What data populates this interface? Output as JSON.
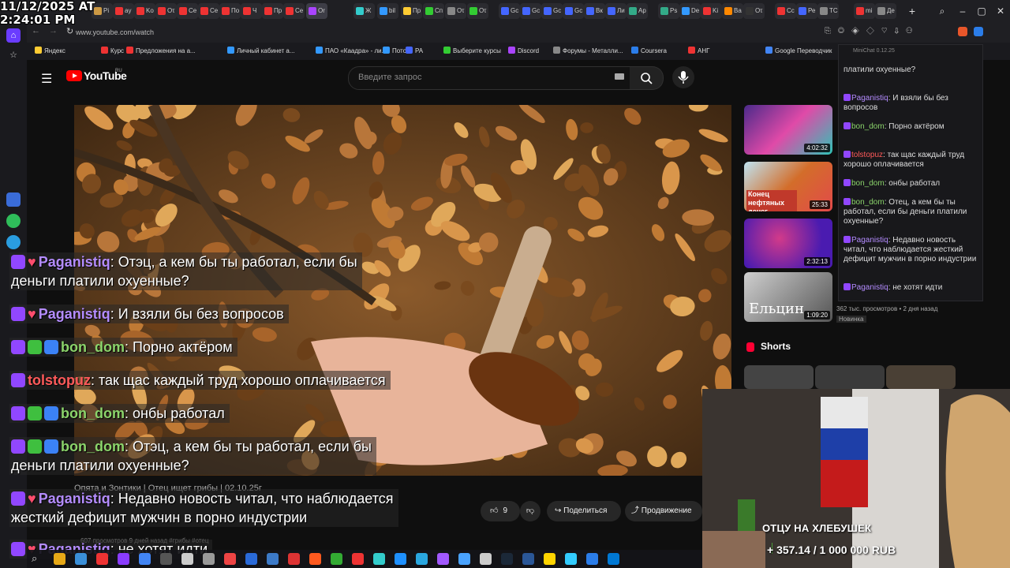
{
  "clock": {
    "date": "11/12/2025 AT",
    "time": "2:24:01 PM"
  },
  "browser": {
    "url": "www.youtube.com/watch",
    "tabs": [
      {
        "label": "Pi",
        "color": "#c94"
      },
      {
        "label": "ay",
        "color": "#e33"
      },
      {
        "label": "Ko",
        "color": "#e33"
      },
      {
        "label": "Oτ",
        "color": "#e33"
      },
      {
        "label": "Ce",
        "color": "#e33"
      },
      {
        "label": "Ce",
        "color": "#e33"
      },
      {
        "label": "Πo",
        "color": "#e33"
      },
      {
        "label": "Ч",
        "color": "#e33"
      },
      {
        "label": "Πр",
        "color": "#e33"
      },
      {
        "label": "Ce",
        "color": "#e33"
      },
      {
        "label": "Or",
        "color": "#a4f"
      },
      {
        "label": "Ж",
        "color": "#3cc"
      },
      {
        "label": "bil",
        "color": "#39f"
      },
      {
        "label": "Пр",
        "color": "#fc3"
      },
      {
        "label": "Сп",
        "color": "#3c3"
      },
      {
        "label": "Oτ",
        "color": "#888"
      },
      {
        "label": "Oτ",
        "color": "#3c3"
      },
      {
        "label": "Gc",
        "color": "#46f"
      },
      {
        "label": "Gc",
        "color": "#46f"
      },
      {
        "label": "Gc",
        "color": "#46f"
      },
      {
        "label": "Gc",
        "color": "#46f"
      },
      {
        "label": "Вк",
        "color": "#46f"
      },
      {
        "label": "Ли",
        "color": "#46f"
      },
      {
        "label": "Ар",
        "color": "#3a8"
      },
      {
        "label": "Ps",
        "color": "#3a8"
      },
      {
        "label": "De",
        "color": "#39f"
      },
      {
        "label": "Ki",
        "color": "#e33"
      },
      {
        "label": "Ва",
        "color": "#f80"
      },
      {
        "label": "Oτ",
        "color": "#333"
      },
      {
        "label": "Сс",
        "color": "#e33"
      },
      {
        "label": "Ре",
        "color": "#46f"
      },
      {
        "label": "TC",
        "color": "#888"
      },
      {
        "label": "mi",
        "color": "#e33"
      },
      {
        "label": "Де",
        "color": "#888"
      }
    ],
    "bookmarks": [
      "Яндекс",
      "Курс",
      "Предложения на а...",
      "Личный кабинет а...",
      "ПАО «Каадра» - ли...",
      "Поток",
      "PA",
      "Выберите курсы",
      "Discord",
      "Форумы - Металли...",
      "Coursera",
      "АНГ",
      "Google Переводчик"
    ]
  },
  "youtube": {
    "logo": "YouTube",
    "region": "RU",
    "search_placeholder": "Введите запрос",
    "channel_line": "Опята и Зонтики | Отец ищет грибы | 02.10.25г",
    "views_line": "607 просмотров 9 дней назад #грибы #отец",
    "like_count": "9",
    "share_label": "Поделиться",
    "thanks_label": "Продвижение",
    "recommendations": [
      {
        "duration": "4:02:32"
      },
      {
        "duration": "25:33",
        "thumb_text": "Конец нефтяных денег"
      },
      {
        "duration": "2:32:13"
      },
      {
        "duration": "1:09:20",
        "thumb_text": "Ельцин"
      }
    ],
    "rec_views": "362 тыс. просмотров • 2 дня назад",
    "rec_new": "Новинка",
    "shorts_label": "Shorts"
  },
  "minichat": {
    "title": "MiniChat 0.12.25",
    "messages": [
      {
        "nick": "",
        "text": "платили охуенные?"
      },
      {
        "nick": "Paganistiq",
        "text": ": И взяли бы без вопросов"
      },
      {
        "nick": "bon_dom",
        "text": ": Порно актёром"
      },
      {
        "nick": "tolstopuz",
        "text": ": так щас каждый труд хорошо оплачивается"
      },
      {
        "nick": "bon_dom",
        "text": ": онбы работал"
      },
      {
        "nick": "bon_dom",
        "text": ": Отец, а кем бы ты работал, если бы деньги платили охуенные?"
      },
      {
        "nick": "Paganistiq",
        "text": ": Недавно новость читал, что наблюдается жесткий дефицит мужчин в порно индустрии"
      },
      {
        "nick": "Paganistiq",
        "text": ": не хотят идти"
      }
    ]
  },
  "overlay_chat": [
    {
      "nick": "Paganistiq",
      "text": ": Отэц, а кем бы ты работал, если бы",
      "cont": "деньги платили охуенные?"
    },
    {
      "nick": "Paganistiq",
      "text": ": И взяли бы без вопросов"
    },
    {
      "nick": "bon_dom",
      "text": ": Порно актёром"
    },
    {
      "nick": "tolstopuz",
      "text": ": так щас каждый труд хорошо оплачивается"
    },
    {
      "nick": "bon_dom",
      "text": ": онбы работал"
    },
    {
      "nick": "bon_dom",
      "text": ": Отэц, а кем бы ты работал, если бы",
      "cont": "деньги платили охуенные?"
    },
    {
      "nick": "Paganistiq",
      "text": ": Недавно новость читал, что наблюдается",
      "cont": "жесткий дефицит мужчин в порно индустрии"
    },
    {
      "nick": "Paganistiq",
      "text": ": не хотят идти"
    }
  ],
  "donation_goal": {
    "title": "ОТЦУ НА ХЛЕБУШЕК",
    "amount": "+ 357.14 / 1 000 000 RUB",
    "raised": 357.14,
    "target": 1000000
  }
}
